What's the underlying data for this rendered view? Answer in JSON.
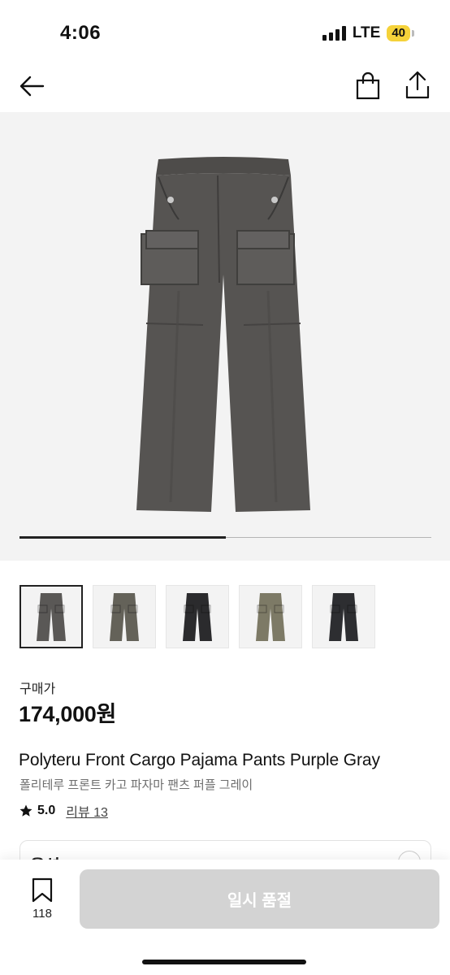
{
  "status_bar": {
    "time": "4:06",
    "network": "LTE",
    "battery": "40",
    "battery_color": "#f5d23a"
  },
  "nav": {
    "back_icon": "arrow-left-icon",
    "bag_icon": "shopping-bag-icon",
    "share_icon": "share-icon"
  },
  "product": {
    "carousel_progress": 0.5,
    "thumbnails": [
      {
        "color_name": "dark gray",
        "color": "#5a5856",
        "selected": true
      },
      {
        "color_name": "olive gray",
        "color": "#646259",
        "selected": false
      },
      {
        "color_name": "black",
        "color": "#2b2b2d",
        "selected": false
      },
      {
        "color_name": "khaki",
        "color": "#7d7a66",
        "selected": false
      },
      {
        "color_name": "black",
        "color": "#2d2e31",
        "selected": false
      }
    ],
    "price_label": "구매가",
    "price": "174,000원",
    "title_en": "Polyteru Front Cargo Pajama Pants Purple Gray",
    "title_ko": "폴리테루 프론트 카고 파자마 팬츠 퍼플 그레이",
    "rating": "5.0",
    "review_label": "리뷰 13",
    "options_label": "옵션"
  },
  "bottom_bar": {
    "bookmark_count": "118",
    "buy_label": "일시 품절",
    "buy_color": "#d3d3d3"
  }
}
